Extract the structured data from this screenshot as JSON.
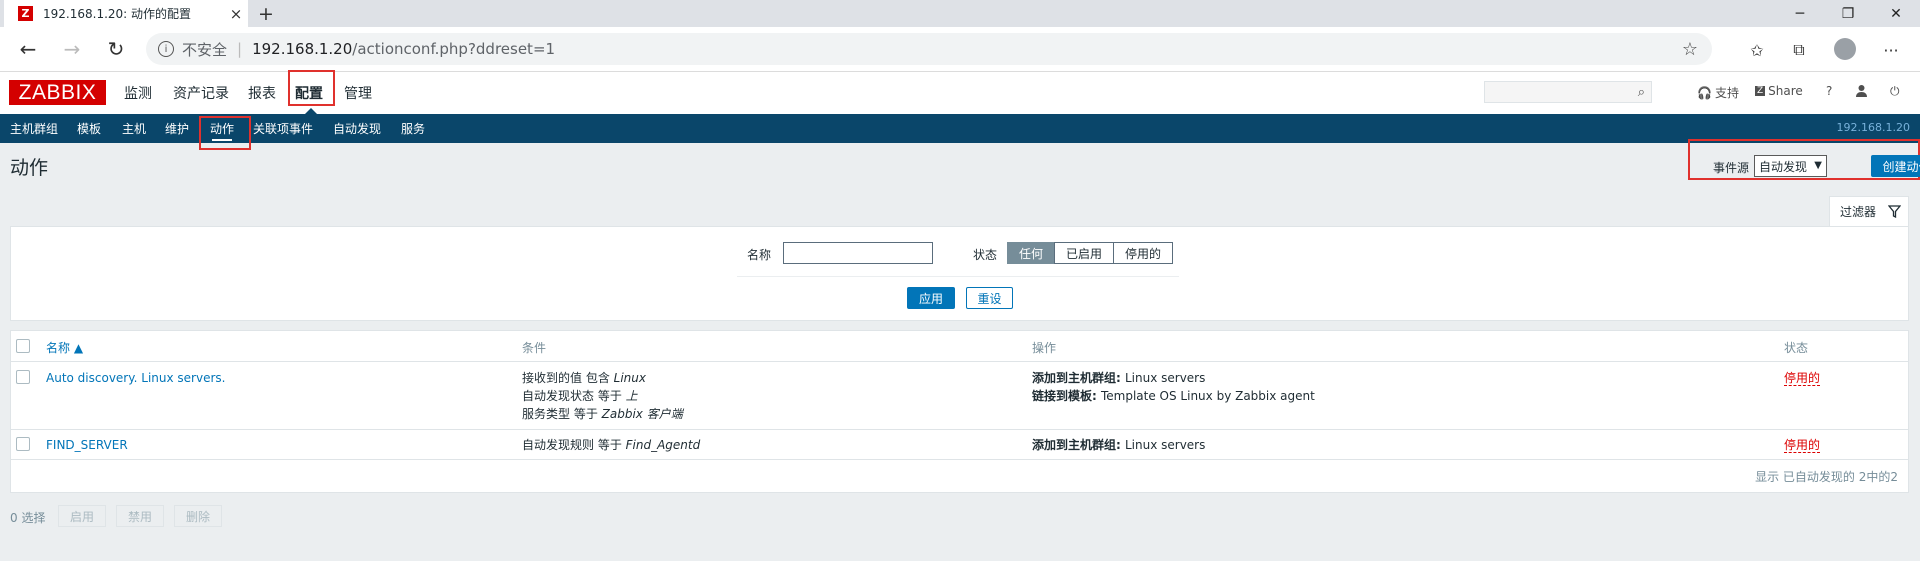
{
  "browser": {
    "tab_title": "192.168.1.20: 动作的配置",
    "tab_favicon": "Z",
    "insecure_label": "不安全",
    "url_host": "192.168.1.20",
    "url_path": "/actionconf.php?ddreset=1"
  },
  "zabbix": {
    "logo": "ZABBIX",
    "main_menu": [
      "监测",
      "资产记录",
      "报表",
      "配置",
      "管理"
    ],
    "header_links": {
      "support": "支持",
      "share": "Share",
      "help": "?"
    },
    "sub_menu": [
      "主机群组",
      "模板",
      "主机",
      "维护",
      "动作",
      "关联项事件",
      "自动发现",
      "服务"
    ],
    "host_ip": "192.168.1.20"
  },
  "page": {
    "title": "动作",
    "event_source_label": "事件源",
    "event_source_value": "自动发现",
    "create_button": "创建动作"
  },
  "filter": {
    "tab_label": "过滤器",
    "name_label": "名称",
    "status_label": "状态",
    "status_options": [
      "任何",
      "已启用",
      "停用的"
    ],
    "selected_status": "任何",
    "apply": "应用",
    "reset": "重设"
  },
  "table": {
    "headers": {
      "name": "名称 ▲",
      "conditions": "条件",
      "operations": "操作",
      "status": "状态"
    },
    "rows": [
      {
        "name": "Auto discovery. Linux servers.",
        "conditions": [
          {
            "text": "接收到的值 包含 ",
            "italic": "Linux"
          },
          {
            "text": "自动发现状态 等于 ",
            "italic": "上"
          },
          {
            "text": "服务类型 等于 ",
            "italic": "Zabbix 客户端"
          }
        ],
        "operations": [
          {
            "bold": "添加到主机群组: ",
            "text": "Linux servers"
          },
          {
            "bold": "链接到模板: ",
            "text": "Template OS Linux by Zabbix agent"
          }
        ],
        "status": "停用的"
      },
      {
        "name": "FIND_SERVER",
        "conditions": [
          {
            "text": "自动发现规则 等于 ",
            "italic": "Find_Agentd"
          }
        ],
        "operations": [
          {
            "bold": "添加到主机群组: ",
            "text": "Linux servers"
          }
        ],
        "status": "停用的"
      }
    ],
    "footer": "显示 已自动发现的 2中的2"
  },
  "mass": {
    "selected": "0 选择",
    "enable": "启用",
    "disable": "禁用",
    "delete": "删除"
  },
  "colors": {
    "accent": "#0275b8",
    "header_bar": "#0a466a",
    "logo": "#d40000",
    "disabled_status": "#dc0000",
    "highlight_box": "#e0312d"
  }
}
